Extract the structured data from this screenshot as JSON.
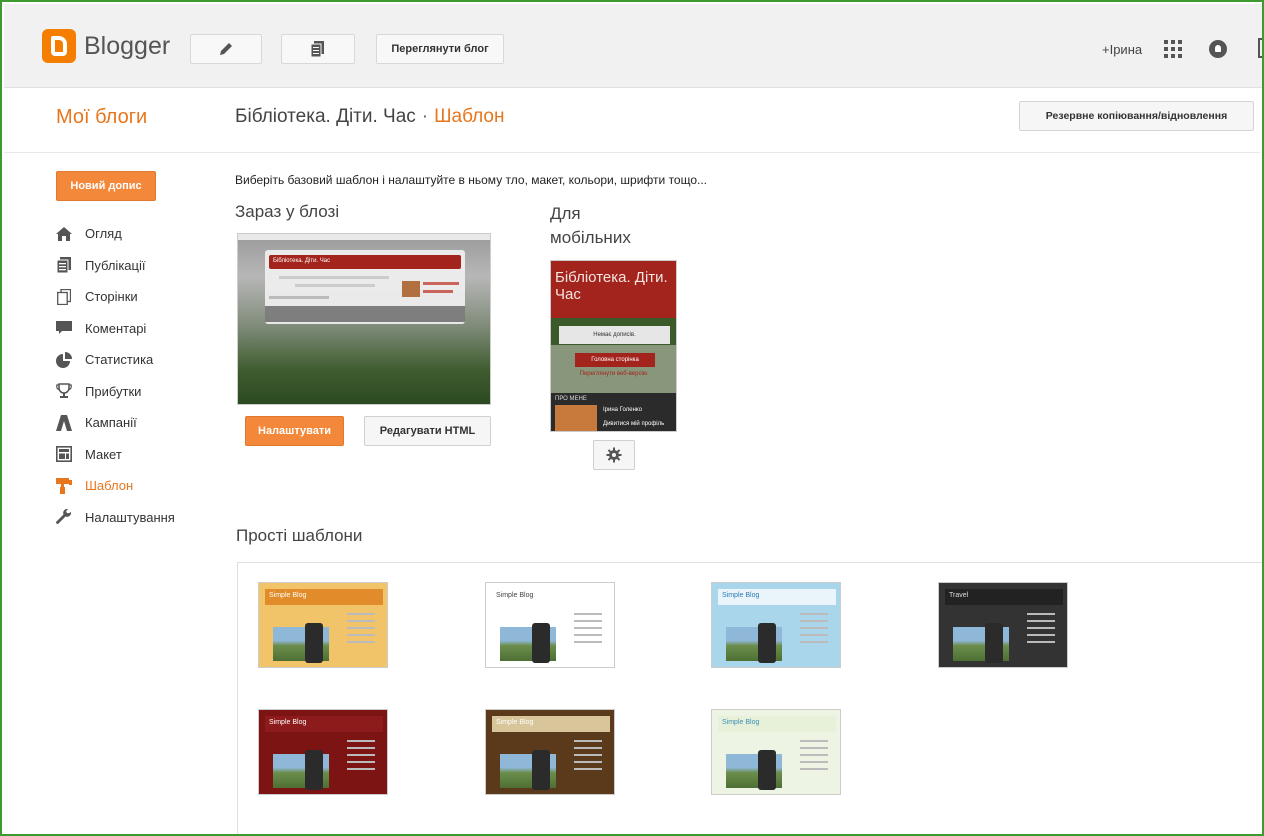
{
  "topbar": {
    "brand": "Blogger",
    "view_blog": "Переглянути блог",
    "user": "+Ірина"
  },
  "header": {
    "my_blogs": "Мої блоги",
    "blog_name": "Бібліотека. Діти. Час",
    "separator": "·",
    "section": "Шаблон",
    "backup_button": "Резервне копіювання/відновлення"
  },
  "sidebar": {
    "new_post": "Новий допис",
    "items": [
      {
        "label": "Огляд",
        "icon": "home-icon"
      },
      {
        "label": "Публікації",
        "icon": "posts-icon"
      },
      {
        "label": "Сторінки",
        "icon": "pages-icon"
      },
      {
        "label": "Коментарі",
        "icon": "comments-icon"
      },
      {
        "label": "Статистика",
        "icon": "stats-icon"
      },
      {
        "label": "Прибутки",
        "icon": "trophy-icon"
      },
      {
        "label": "Кампанії",
        "icon": "campaigns-icon"
      },
      {
        "label": "Макет",
        "icon": "layout-icon"
      },
      {
        "label": "Шаблон",
        "icon": "template-icon",
        "active": true
      },
      {
        "label": "Налаштування",
        "icon": "wrench-icon"
      }
    ]
  },
  "main": {
    "intro": "Виберіть базовий шаблон і налаштуйте в ньому тло, макет, кольори, шрифти тощо...",
    "now_title": "Зараз у блозі",
    "mobile_title": "Для мобільних",
    "customize_button": "Налаштувати",
    "edit_html_button": "Редагувати HTML",
    "preview": {
      "blog_title": "Бібліотека. Діти. Час"
    },
    "mobile_preview": {
      "title": "Бібліотека. Діти. Час",
      "no_posts": "Немає дописів.",
      "home": "Головна сторінка",
      "web_version": "Переглянути веб-версію",
      "about": "ПРО МЕНЕ",
      "name": "Ірина Голенко",
      "profile_link": "Дивитися мій профіль"
    },
    "simple_title": "Прості шаблони",
    "templates": [
      {
        "title": "Simple Blog",
        "header_bg": "#e18b2a",
        "title_color": "#fff",
        "bg": "#f1c46a"
      },
      {
        "title": "Simple Blog",
        "header_bg": "#ffffff",
        "title_color": "#444",
        "bg": "#ffffff"
      },
      {
        "title": "Simple Blog",
        "header_bg": "#eaf4fb",
        "title_color": "#2b7bb9",
        "bg": "#a9d6ea"
      },
      {
        "title": "Travel",
        "header_bg": "#222222",
        "title_color": "#ddd",
        "bg": "#333333"
      },
      {
        "title": "Simple Blog",
        "header_bg": "#8e1b1b",
        "title_color": "#fff",
        "bg": "#7d1414"
      },
      {
        "title": "Simple Blog",
        "header_bg": "#d8c69a",
        "title_color": "#fff",
        "bg": "#5a3a1a"
      },
      {
        "title": "Simple Blog",
        "header_bg": "#e7f0d8",
        "title_color": "#3d8fb8",
        "bg": "#eef4e4"
      }
    ]
  },
  "colors": {
    "accent": "#e8761c",
    "button_orange": "#f3873a",
    "frame_green": "#3c9a2e"
  }
}
